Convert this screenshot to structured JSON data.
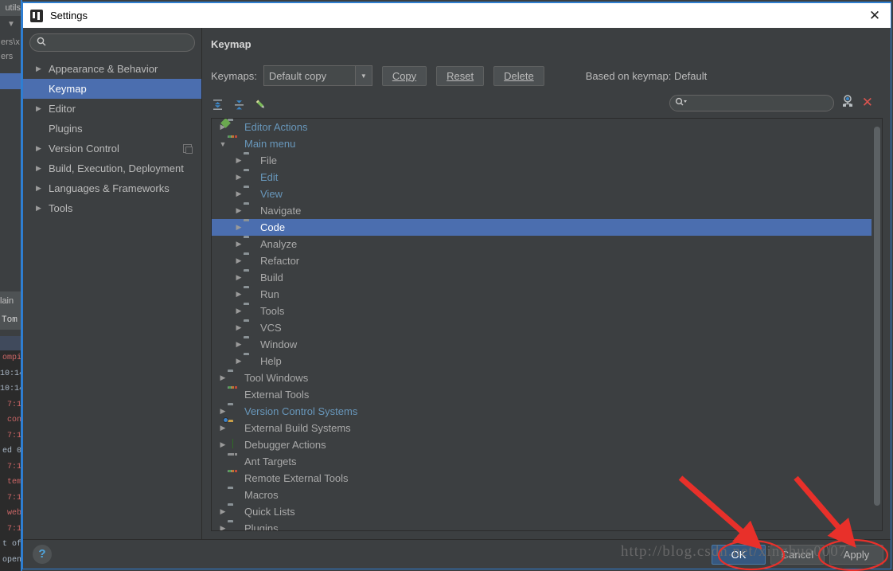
{
  "background_ide": {
    "top_tab": "utils",
    "toolbar_glyph": "▼",
    "path_line1": "ers\\x",
    "path_line2": "ers",
    "status_label": "lain",
    "tab_label": "Tom",
    "console_lines": [
      {
        "text": "ompi",
        "color": "red"
      },
      {
        "text": "10:14",
        "color": "gray"
      },
      {
        "text": "10:14",
        "color": "gray"
      },
      {
        "text": "7:1",
        "color": "red"
      },
      {
        "text": "con",
        "color": "red"
      },
      {
        "text": "7:1",
        "color": "red"
      },
      {
        "text": "ed 0",
        "color": "gray"
      },
      {
        "text": "7:1",
        "color": "red"
      },
      {
        "text": "tem",
        "color": "red"
      },
      {
        "text": "7:1",
        "color": "red"
      },
      {
        "text": "web",
        "color": "red"
      },
      {
        "text": "7:1",
        "color": "red"
      },
      {
        "text": "t of",
        "color": "gray"
      },
      {
        "text": "open",
        "color": "gray"
      }
    ]
  },
  "dialog": {
    "title": "Settings",
    "close_label": "✕",
    "app_icon": "intellij-logo-icon"
  },
  "sidebar": {
    "search": {
      "value": "",
      "placeholder": ""
    },
    "items": [
      {
        "label": "Appearance & Behavior",
        "expandable": true,
        "selected": false,
        "badge": false
      },
      {
        "label": "Keymap",
        "expandable": false,
        "selected": true,
        "badge": false
      },
      {
        "label": "Editor",
        "expandable": true,
        "selected": false,
        "badge": false
      },
      {
        "label": "Plugins",
        "expandable": false,
        "selected": false,
        "badge": false
      },
      {
        "label": "Version Control",
        "expandable": true,
        "selected": false,
        "badge": true
      },
      {
        "label": "Build, Execution, Deployment",
        "expandable": true,
        "selected": false,
        "badge": false
      },
      {
        "label": "Languages & Frameworks",
        "expandable": true,
        "selected": false,
        "badge": false
      },
      {
        "label": "Tools",
        "expandable": true,
        "selected": false,
        "badge": false
      }
    ]
  },
  "panel": {
    "title": "Keymap",
    "keymaps_label": "Keymaps:",
    "keymap_selected": "Default copy",
    "dropdown_glyph": "▼",
    "buttons": {
      "copy": "Copy",
      "reset": "Reset",
      "delete": "Delete"
    },
    "based_on": "Based on keymap: Default",
    "toolbar_icons": [
      "expand-all-icon",
      "collapse-all-icon",
      "edit-shortcut-icon"
    ],
    "filter": {
      "value": "",
      "placeholder": ""
    },
    "filter_icons": [
      "find-by-shortcut-icon",
      "clear-filter-icon"
    ],
    "scroll": {
      "thumb_top_pct": 2,
      "thumb_height_pct": 92
    }
  },
  "tree": [
    {
      "label": "Editor Actions",
      "depth": 0,
      "arrow": "collapsed",
      "icon": "editor-actions-icon",
      "style": "blue",
      "selected": false
    },
    {
      "label": "Main menu",
      "depth": 0,
      "arrow": "expanded",
      "icon": "main-menu-icon",
      "style": "blue",
      "selected": false
    },
    {
      "label": "File",
      "depth": 1,
      "arrow": "collapsed",
      "icon": "folder-icon",
      "style": "plain",
      "selected": false
    },
    {
      "label": "Edit",
      "depth": 1,
      "arrow": "collapsed",
      "icon": "folder-icon",
      "style": "blue",
      "selected": false
    },
    {
      "label": "View",
      "depth": 1,
      "arrow": "collapsed",
      "icon": "folder-icon",
      "style": "blue",
      "selected": false
    },
    {
      "label": "Navigate",
      "depth": 1,
      "arrow": "collapsed",
      "icon": "folder-icon",
      "style": "plain",
      "selected": false
    },
    {
      "label": "Code",
      "depth": 1,
      "arrow": "collapsed",
      "icon": "folder-icon",
      "style": "plain",
      "selected": true
    },
    {
      "label": "Analyze",
      "depth": 1,
      "arrow": "collapsed",
      "icon": "folder-icon",
      "style": "plain",
      "selected": false
    },
    {
      "label": "Refactor",
      "depth": 1,
      "arrow": "collapsed",
      "icon": "folder-icon",
      "style": "plain",
      "selected": false
    },
    {
      "label": "Build",
      "depth": 1,
      "arrow": "collapsed",
      "icon": "folder-icon",
      "style": "plain",
      "selected": false
    },
    {
      "label": "Run",
      "depth": 1,
      "arrow": "collapsed",
      "icon": "folder-icon",
      "style": "plain",
      "selected": false
    },
    {
      "label": "Tools",
      "depth": 1,
      "arrow": "collapsed",
      "icon": "folder-icon",
      "style": "plain",
      "selected": false
    },
    {
      "label": "VCS",
      "depth": 1,
      "arrow": "collapsed",
      "icon": "folder-icon",
      "style": "plain",
      "selected": false
    },
    {
      "label": "Window",
      "depth": 1,
      "arrow": "collapsed",
      "icon": "folder-icon",
      "style": "plain",
      "selected": false
    },
    {
      "label": "Help",
      "depth": 1,
      "arrow": "collapsed",
      "icon": "folder-icon",
      "style": "plain",
      "selected": false
    },
    {
      "label": "Tool Windows",
      "depth": 0,
      "arrow": "collapsed",
      "icon": "folder-icon",
      "style": "plain",
      "selected": false
    },
    {
      "label": "External Tools",
      "depth": 0,
      "arrow": "none",
      "icon": "external-tools-icon",
      "style": "plain",
      "selected": false
    },
    {
      "label": "Version Control Systems",
      "depth": 0,
      "arrow": "collapsed",
      "icon": "folder-icon",
      "style": "blue",
      "selected": false
    },
    {
      "label": "External Build Systems",
      "depth": 0,
      "arrow": "collapsed",
      "icon": "build-folder-icon",
      "style": "plain",
      "selected": false
    },
    {
      "label": "Debugger Actions",
      "depth": 0,
      "arrow": "collapsed",
      "icon": "debugger-bug-icon",
      "style": "plain",
      "selected": false
    },
    {
      "label": "Ant Targets",
      "depth": 0,
      "arrow": "none",
      "icon": "ant-targets-icon",
      "style": "plain",
      "selected": false
    },
    {
      "label": "Remote External Tools",
      "depth": 0,
      "arrow": "none",
      "icon": "external-tools-icon",
      "style": "plain",
      "selected": false
    },
    {
      "label": "Macros",
      "depth": 0,
      "arrow": "none",
      "icon": "folder-icon",
      "style": "plain",
      "selected": false
    },
    {
      "label": "Quick Lists",
      "depth": 0,
      "arrow": "collapsed",
      "icon": "folder-icon",
      "style": "plain",
      "selected": false
    },
    {
      "label": "Plugins",
      "depth": 0,
      "arrow": "collapsed",
      "icon": "folder-icon",
      "style": "plain",
      "selected": false
    }
  ],
  "footer": {
    "help_label": "?",
    "ok": "OK",
    "cancel": "Cancel",
    "apply": "Apply"
  },
  "watermark": {
    "text": "http://blog.csdn.net/xinghuo0007"
  },
  "colors": {
    "window_bg": "#3c3f41",
    "selection_blue": "#4b6eaf",
    "link_blue": "#6897bb",
    "primary_button": "#365880",
    "annotation_red": "#e02020",
    "titlebar": "#ffffff",
    "border_blue": "#2d7dd2"
  }
}
